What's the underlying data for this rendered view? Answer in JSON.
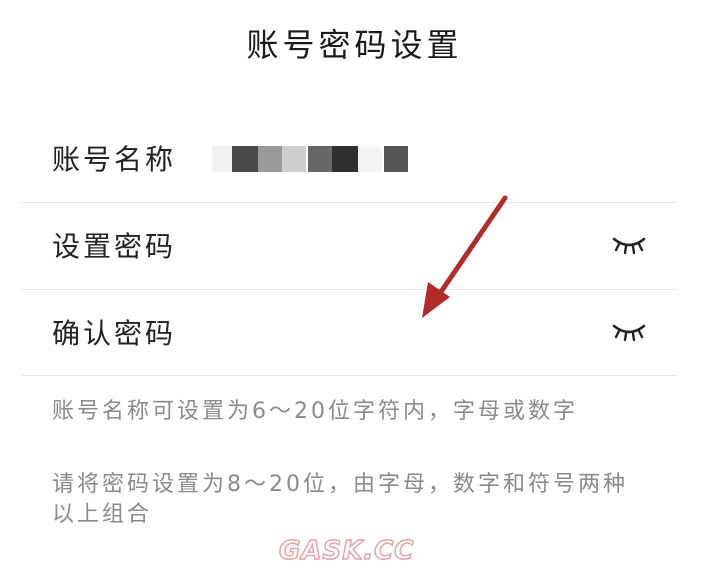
{
  "header": {
    "title": "账号密码设置"
  },
  "form": {
    "account_name": {
      "label": "账号名称"
    },
    "set_password": {
      "label": "设置密码",
      "toggle_icon": "eye-closed-icon"
    },
    "confirm_password": {
      "label": "确认密码",
      "toggle_icon": "eye-closed-icon"
    }
  },
  "hints": {
    "line1": "账号名称可设置为6～20位字符内，字母或数字",
    "line2": "请将密码设置为8～20位，由字母，数字和符号两种以上组合"
  },
  "annotation": {
    "arrow_color": "#b22a2a"
  },
  "watermark": {
    "text": "GASK.CC"
  }
}
